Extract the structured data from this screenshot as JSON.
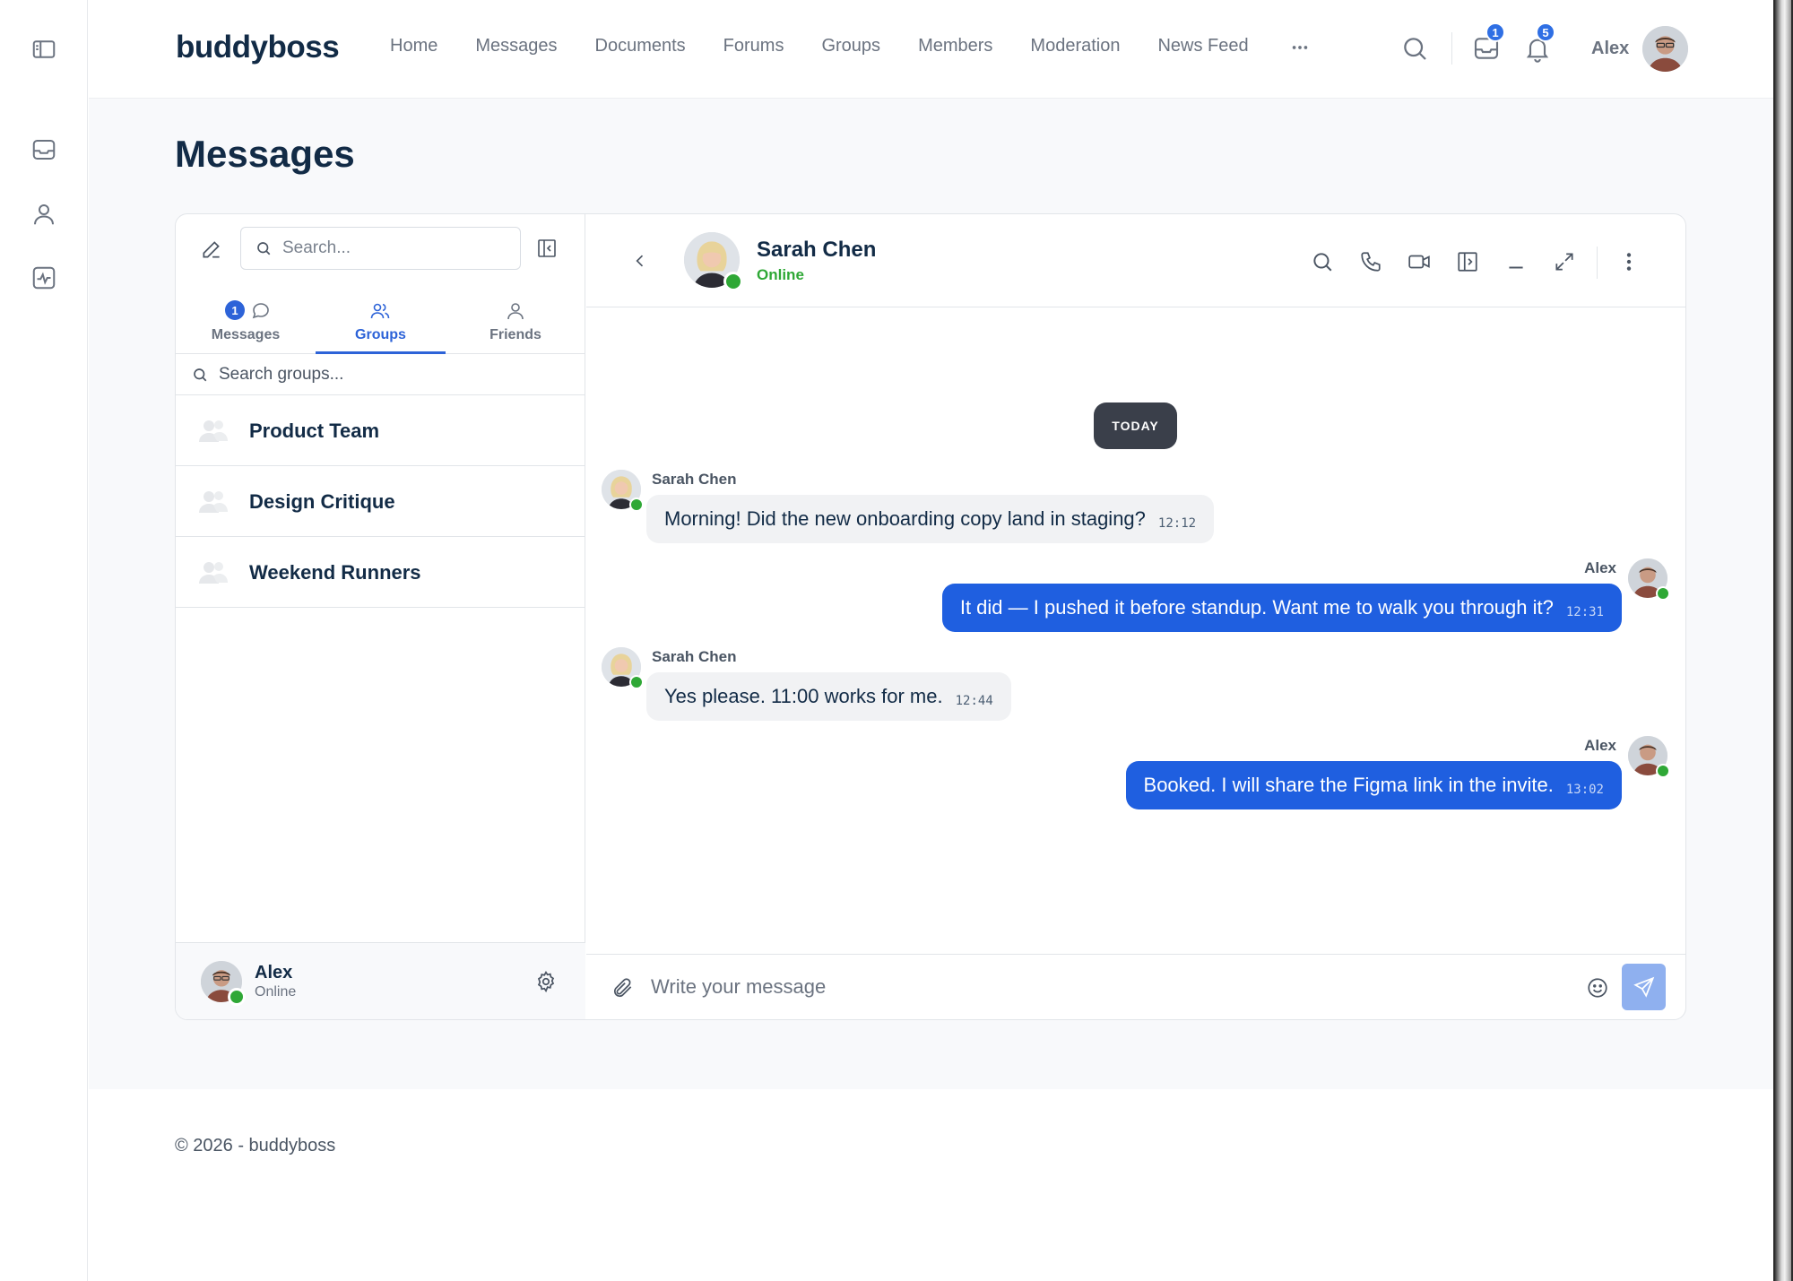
{
  "brand": "buddyboss",
  "nav": [
    "Home",
    "Messages",
    "Documents",
    "Forums",
    "Groups",
    "Members",
    "Moderation",
    "News Feed"
  ],
  "header": {
    "inbox_count": "1",
    "notification_count": "5",
    "user_name": "Alex"
  },
  "page_title": "Messages",
  "sidebar": {
    "search_placeholder": "Search...",
    "tabs": [
      {
        "label": "Messages",
        "badge": "1",
        "icon": "chat-bubble-icon"
      },
      {
        "label": "Groups",
        "icon": "users-icon",
        "active": true
      },
      {
        "label": "Friends",
        "icon": "user-icon"
      }
    ],
    "group_search_placeholder": "Search groups...",
    "groups": [
      "Product Team",
      "Design Critique",
      "Weekend Runners"
    ],
    "current_user": {
      "name": "Alex",
      "status": "Online"
    }
  },
  "chat": {
    "contact_name": "Sarah Chen",
    "contact_status": "Online",
    "day_label": "TODAY",
    "messages": [
      {
        "sender": "Sarah Chen",
        "text": "Morning! Did the new onboarding copy land in staging?",
        "time": "12:12",
        "direction": "in"
      },
      {
        "sender": "Alex",
        "text": "It did — I pushed it before standup. Want me to walk you through it?",
        "time": "12:31",
        "direction": "out"
      },
      {
        "sender": "Sarah Chen",
        "text": "Yes please. 11:00 works for me.",
        "time": "12:44",
        "direction": "in"
      },
      {
        "sender": "Alex",
        "text": "Booked. I will share the Figma link in the invite.",
        "time": "13:02",
        "direction": "out"
      }
    ],
    "composer_placeholder": "Write your message"
  },
  "footer": "© 2026 - buddyboss",
  "colors": {
    "accent": "#2d63d8",
    "online": "#2fa836",
    "outgoing_bubble": "#1f5fe0",
    "send_button": "#8fb0ef"
  }
}
